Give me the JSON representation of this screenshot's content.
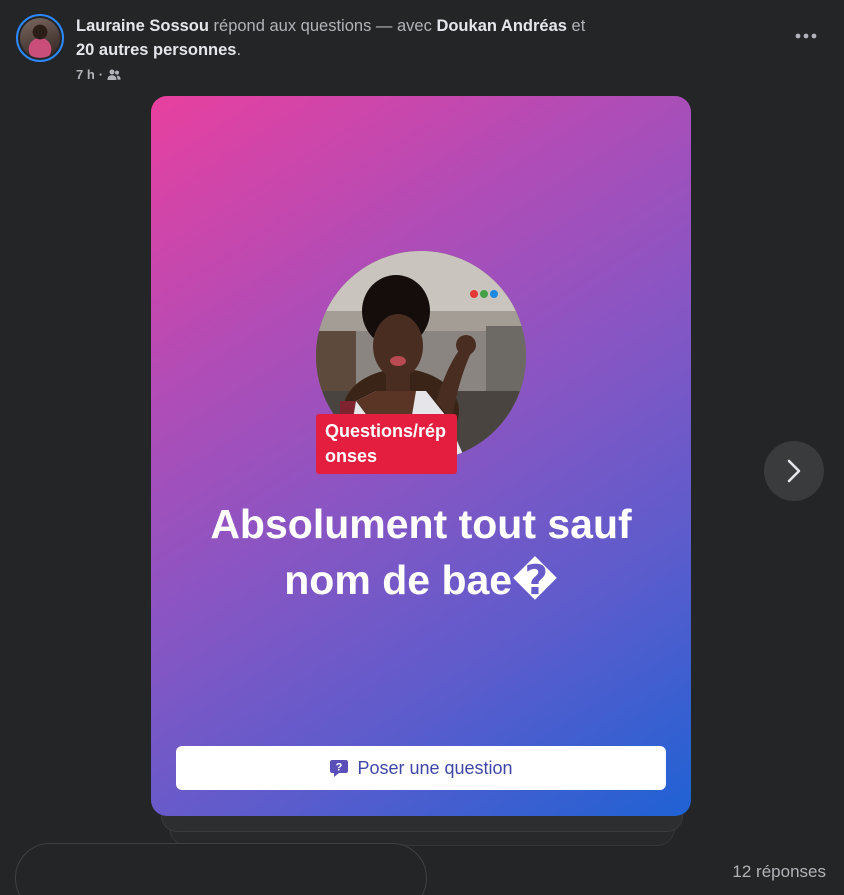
{
  "post": {
    "author": "Lauraine Sossou",
    "action": " répond aux questions — avec ",
    "tagged": "Doukan Andréas",
    "conjunction": " et",
    "others": "20 autres personnes",
    "period": ".",
    "time": "7 h",
    "separator": "·",
    "audience_icon": "friends-icon",
    "more_icon": "more-options-icon"
  },
  "card": {
    "badge": "Questions/réponses",
    "question": "Absolument tout sauf nom de bae�",
    "ask_button": "Poser une question",
    "ask_icon": "question-bubble-icon",
    "gradient_start": "#e8409f",
    "gradient_end": "#1f62d4",
    "badge_color": "#e41e3f"
  },
  "navigation": {
    "next_icon": "chevron-right-icon"
  },
  "footer": {
    "replies": "12 réponses"
  }
}
